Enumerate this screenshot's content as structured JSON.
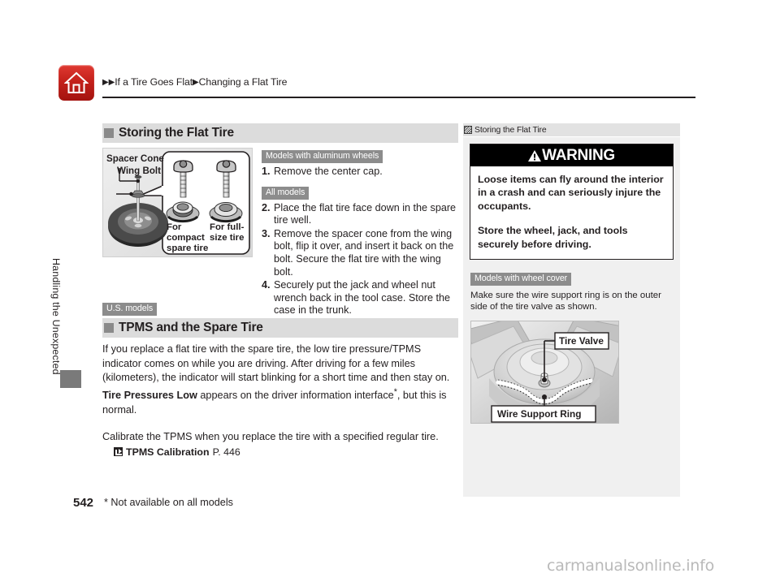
{
  "header": {
    "home_icon": "home-icon",
    "breadcrumb_prefix": "▶▶",
    "breadcrumb_1": "If a Tire Goes Flat",
    "breadcrumb_sep": "▶",
    "breadcrumb_2": "Changing a Flat Tire"
  },
  "spine": {
    "chapter_label": "Handling the Unexpected"
  },
  "footer": {
    "page_number": "542",
    "footnote": "* Not available on all models",
    "watermark": "carmanualsonline.info"
  },
  "main": {
    "section_title": "Storing the Flat Tire",
    "figure": {
      "label_spacer_cone": "Spacer Cone",
      "label_wing_bolt": "Wing Bolt",
      "label_compact": "For\ncompact\nspare tire",
      "label_compact_l1": "For",
      "label_compact_l2": "compact",
      "label_compact_l3": "spare tire",
      "label_fullsize_l1": "For full-",
      "label_fullsize_l2": "size tire"
    },
    "steps": {
      "tag_aluminum": "Models with aluminum wheels",
      "tag_all": "All models",
      "items": [
        {
          "num": "1.",
          "text": "Remove the center cap."
        },
        {
          "num": "2.",
          "text": "Place the flat tire face down in the spare tire well."
        },
        {
          "num": "3.",
          "text": "Remove the spacer cone from the wing bolt, flip it over, and insert it back on the bolt. Secure the flat tire with the wing bolt."
        },
        {
          "num": "4.",
          "text": "Securely put the jack and wheel nut wrench back in the tool case. Store the case in the trunk."
        }
      ]
    },
    "tpms": {
      "tag_us": "U.S. models",
      "section_title": "TPMS and the Spare Tire",
      "para1_a": "If you replace a flat tire with the spare tire, the low tire pressure/TPMS indicator comes on while you are driving. After driving for a few miles (kilometers), the indicator will start blinking for a short time and then stay on. ",
      "para1_bold": "Tire Pressures Low",
      "para1_b": " appears on the driver information interface",
      "para1_star": "*",
      "para1_c": ", but this is normal.",
      "para2": "Calibrate the TPMS when you replace the tire with a specified regular tire.",
      "xref_label": "TPMS Calibration",
      "xref_page": "P. 446"
    }
  },
  "sidebar": {
    "head_title": "Storing the Flat Tire",
    "warning": {
      "title": "WARNING",
      "para1": "Loose items can fly around the interior in a crash and can seriously injure the occupants.",
      "para2": "Store the wheel, jack, and tools securely before driving."
    },
    "tag_wheel_cover": "Models with wheel cover",
    "note": "Make sure the wire support ring is on the outer side of the tire valve as shown.",
    "figure": {
      "label_tire_valve": "Tire Valve",
      "label_wire_support_ring": "Wire Support Ring"
    }
  },
  "colors": {
    "home_red": "#c4211b",
    "band_gray": "#dcdcdc",
    "tag_gray": "#8c8c8c",
    "sidebar_bg": "#f0f0f0",
    "warning_black": "#000000",
    "text": "#231f20"
  }
}
